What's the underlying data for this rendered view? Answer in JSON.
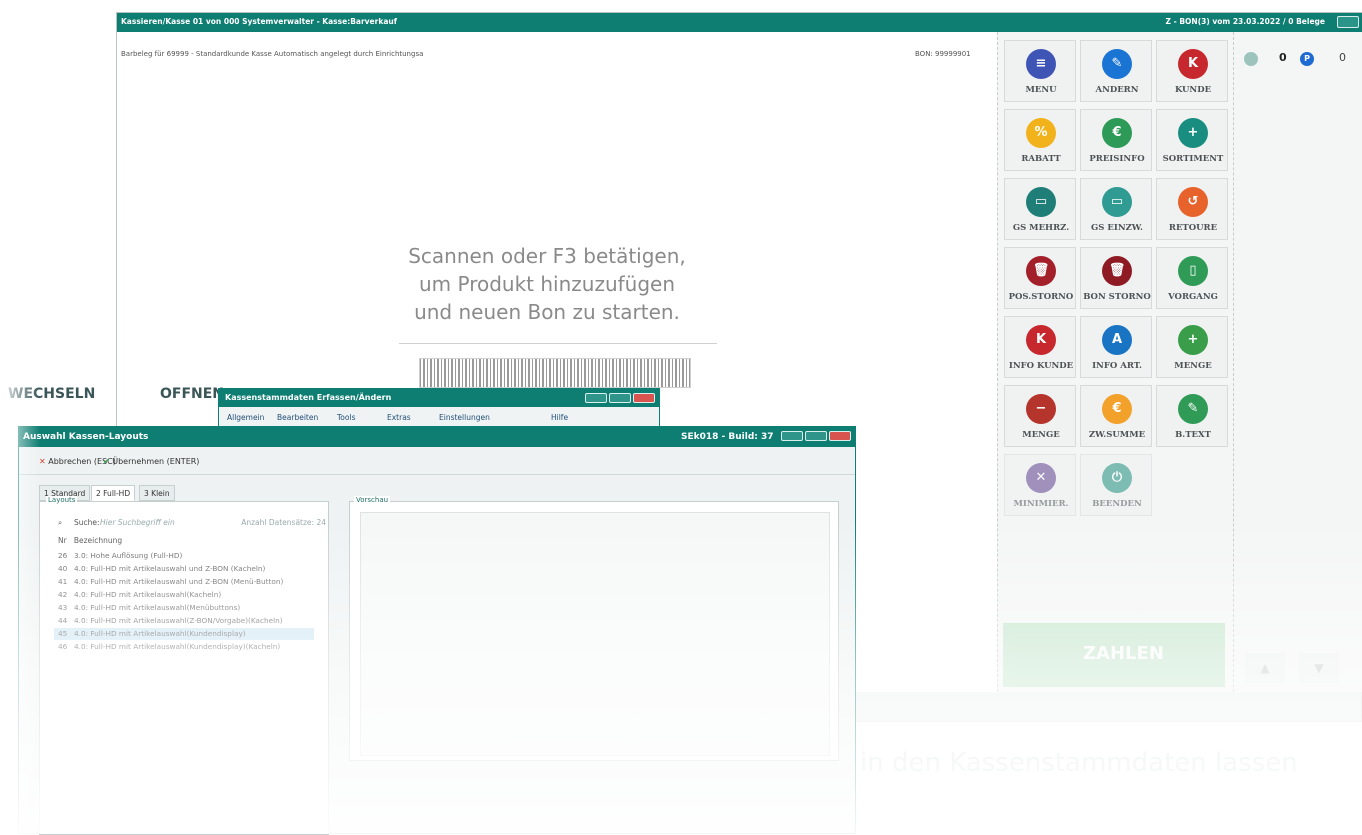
{
  "pos": {
    "title": "Kassieren/Kasse 01 von 000 Systemverwalter - Kasse:Barverkauf",
    "status_right": "Z - BON(3) vom 23.03.2022 / 0 Belege",
    "receipt_header": "Barbeleg für 69999 - Standardkunde Kasse Automatisch angelegt durch Einrichtungsa",
    "bon_number": "BON: 99999901",
    "scan_prompt_line1": "Scannen oder F3 betätigen,",
    "scan_prompt_line2": "um Produkt hinzuzufügen",
    "scan_prompt_line3": "und neuen Bon zu starten.",
    "counter1_value": "0",
    "counter2_icon": "P",
    "counter2_value": "0",
    "pay_label": "ZAHLEN",
    "buttons": [
      {
        "label": "MENÜ",
        "icon": "menu-icon",
        "glyph": "≡",
        "color": "#3f55b5"
      },
      {
        "label": "ÄNDERN",
        "icon": "pencil-icon",
        "glyph": "✎",
        "color": "#1a74d4"
      },
      {
        "label": "KUNDE",
        "icon": "customer-icon",
        "glyph": "K",
        "color": "#c6282d"
      },
      {
        "label": "RABATT",
        "icon": "discount-icon",
        "glyph": "%",
        "color": "#f2b21c"
      },
      {
        "label": "PREISINFO",
        "icon": "price-info-icon",
        "glyph": "€",
        "color": "#2e9a57"
      },
      {
        "label": "SORTIMENT",
        "icon": "assortment-icon",
        "glyph": "+",
        "color": "#198d80"
      },
      {
        "label": "GS MEHRZ.",
        "icon": "voucher-multi-icon",
        "glyph": "▭",
        "color": "#1f7f78"
      },
      {
        "label": "GS EINZW.",
        "icon": "voucher-single-icon",
        "glyph": "▭",
        "color": "#2f9b93"
      },
      {
        "label": "RETOURE",
        "icon": "return-icon",
        "glyph": "↺",
        "color": "#e8632c"
      },
      {
        "label": "POS.STORNO",
        "icon": "trash-icon",
        "glyph": "🗑",
        "color": "#a3202a"
      },
      {
        "label": "BON STORNO",
        "icon": "receipt-trash-icon",
        "glyph": "🗑",
        "color": "#8e1b24"
      },
      {
        "label": "VORGANG",
        "icon": "document-icon",
        "glyph": "▯",
        "color": "#2f9b57"
      },
      {
        "label": "INFO KUNDE",
        "icon": "customer-info-icon",
        "glyph": "K",
        "color": "#c6282d"
      },
      {
        "label": "INFO ART.",
        "icon": "article-info-icon",
        "glyph": "A",
        "color": "#1a74c4"
      },
      {
        "label": "MENGE",
        "icon": "quantity-plus-icon",
        "glyph": "+",
        "color": "#3a9d4a"
      },
      {
        "label": "MENGE",
        "icon": "quantity-minus-icon",
        "glyph": "−",
        "color": "#b5342b"
      },
      {
        "label": "ZW.SUMME",
        "icon": "subtotal-icon",
        "glyph": "€",
        "color": "#f2a12b"
      },
      {
        "label": "B.TEXT",
        "icon": "text-icon",
        "glyph": "✎",
        "color": "#2f9b57"
      },
      {
        "label": "MINIMIER.",
        "icon": "minimize-icon",
        "glyph": "✕",
        "color": "#5b3f8f"
      },
      {
        "label": "BEENDEN",
        "icon": "power-icon",
        "glyph": "⏻",
        "color": "#1c8f7d"
      }
    ]
  },
  "background": {
    "wechseln": "WECHSELN",
    "offnen": "OFFNEN"
  },
  "kassen_dialog": {
    "title": "Kassenstammdaten Erfassen/Ändern",
    "menu": [
      "Allgemein",
      "Bearbeiten",
      "Tools",
      "Extras",
      "Einstellungen",
      "Hilfe"
    ]
  },
  "layouts_dialog": {
    "title": "Auswahl Kassen-Layouts",
    "build": "SEk018 - Build: 37",
    "cancel_label": "Abbrechen (ESC)",
    "apply_label": "Übernehmen (ENTER)",
    "tabs": [
      "1 Standard",
      "2 Full-HD",
      "3 Klein"
    ],
    "group_label": "Layouts",
    "search_label": "Suche:",
    "search_placeholder": "Hier Suchbegriff ein",
    "count_label": "Anzahl Datensätze: 24",
    "col_nr": "Nr",
    "col_desc": "Bezeichnung",
    "rows": [
      {
        "nr": "26",
        "text": "3.0: Hohe Auflösung (Full-HD)"
      },
      {
        "nr": "40",
        "text": "4.0: Full-HD mit Artikelauswahl und Z-BON (Kacheln)"
      },
      {
        "nr": "41",
        "text": "4.0: Full-HD mit Artikelauswahl und Z-BON (Menü-Button)"
      },
      {
        "nr": "42",
        "text": "4.0: Full-HD mit Artikelauswahl(Kacheln)"
      },
      {
        "nr": "43",
        "text": "4.0: Full-HD mit Artikelauswahl(Menübuttons)"
      },
      {
        "nr": "44",
        "text": "4.0: Full-HD mit Artikelauswahl(Z-BON/Vorgabe)(Kacheln)"
      },
      {
        "nr": "45",
        "text": "4.0: Full-HD mit Artikelauswahl(Kundendisplay)"
      },
      {
        "nr": "46",
        "text": "4.0: Full-HD mit Artikelauswahl(Kundendisplay)(Kacheln)"
      }
    ],
    "preview_label": "Vorschau"
  },
  "caption": "in den Kassenstammdaten lassen"
}
